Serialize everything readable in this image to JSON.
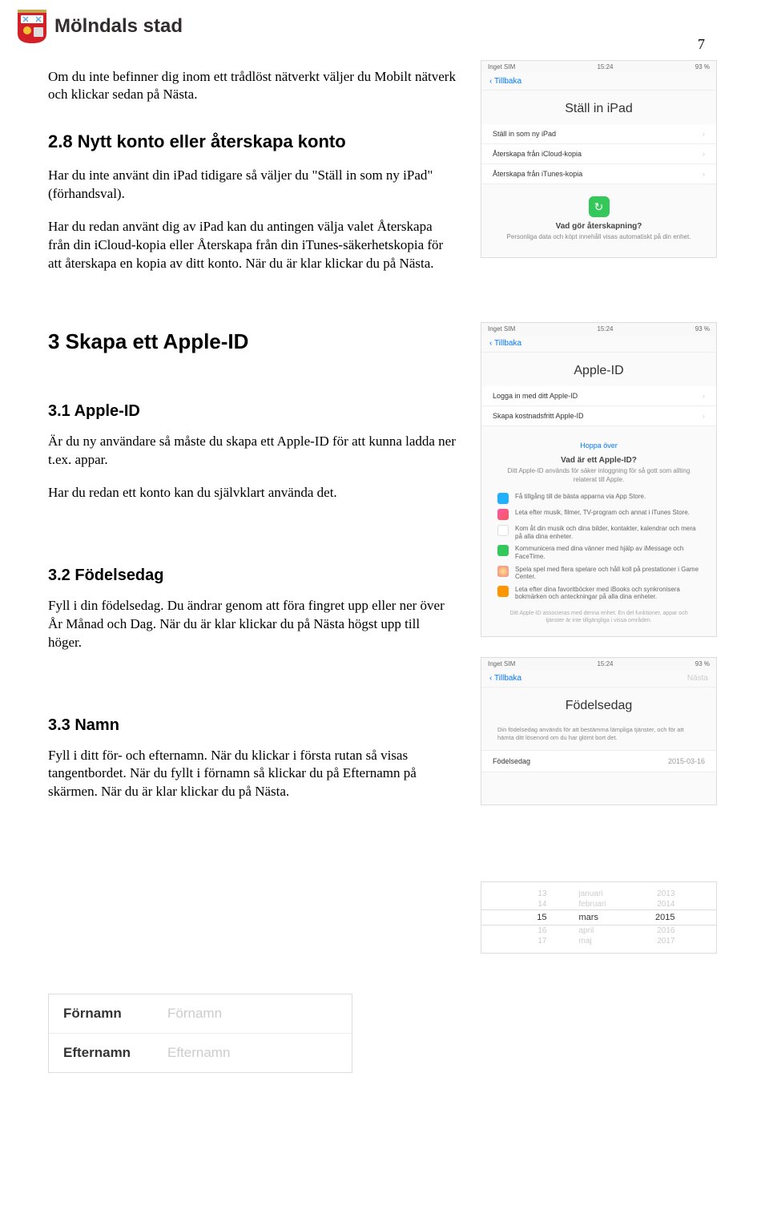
{
  "header": {
    "logo_text": "Mölndals stad",
    "page_number": "7"
  },
  "intro": "Om du inte befinner dig inom ett trådlöst nätverkt väljer du Mobilt nätverk och klickar sedan på Nästa.",
  "sec28": {
    "title": "2.8  Nytt konto eller återskapa konto",
    "p1": "Har du inte använt din iPad tidigare så väljer du \"Ställ in som ny iPad\" (förhandsval).",
    "p2": "Har du redan använt dig av iPad kan du antingen välja valet Återskapa från din iCloud-kopia eller Återskapa från din iTunes-säkerhetskopia för att återskapa en kopia av ditt konto. När du är klar klickar du på Nästa."
  },
  "sec3": {
    "title": "3  Skapa ett Apple-ID"
  },
  "sec31": {
    "title": "3.1  Apple-ID",
    "p1": "Är du ny användare så måste du skapa ett Apple-ID för att kunna ladda ner t.ex. appar.",
    "p2": "Har du redan ett konto kan du självklart använda det."
  },
  "sec32": {
    "title": "3.2  Födelsedag",
    "p1": "Fyll i din födelsedag. Du ändrar genom att föra fingret upp eller ner över År Månad och Dag. När du är klar klickar du på Nästa högst upp till höger."
  },
  "sec33": {
    "title": "3.3  Namn",
    "p1": "Fyll i ditt för- och efternamn. När du klickar i första rutan så visas tangentbordet. När du fyllt i förnamn så klickar du på Efternamn på skärmen. När du är klar klickar du på Nästa."
  },
  "ipad1": {
    "status_left": "Inget SIM",
    "status_mid": "15:24",
    "status_right": "93 %",
    "back": "Tillbaka",
    "title": "Ställ in iPad",
    "opt1": "Ställ in som ny iPad",
    "opt2": "Återskapa från iCloud-kopia",
    "opt3": "Återskapa från iTunes-kopia",
    "info_title": "Vad gör återskapning?",
    "info_desc": "Personliga data och köpt innehåll visas automatiskt på din enhet."
  },
  "ipad2": {
    "status_left": "Inget SIM",
    "status_mid": "15:24",
    "status_right": "93 %",
    "back": "Tillbaka",
    "title": "Apple-ID",
    "opt1": "Logga in med ditt Apple-ID",
    "opt2": "Skapa kostnadsfritt Apple-ID",
    "skip": "Hoppa över",
    "info_title": "Vad är ett Apple-ID?",
    "info_desc": "Ditt Apple-ID används för säker inloggning för så gott som allting relaterat till Apple.",
    "f1": "Få tillgång till de bästa apparna via App Store.",
    "f2": "Leta efter musik, filmer, TV-program och annat i iTunes Store.",
    "f3": "Kom åt din musik och dina bilder, kontakter, kalendrar och mera på alla dina enheter.",
    "f4": "Kommunicera med dina vänner med hjälp av iMessage och FaceTime.",
    "f5": "Spela spel med flera spelare och håll koll på prestationer i Game Center.",
    "f6": "Leta efter dina favoritböcker med iBooks och synkronisera bokmärken och anteckningar på alla dina enheter.",
    "fine": "Ditt Apple-ID associeras med denna enhet. En del funktioner, appar och tjänster är inte tillgängliga i vissa områden."
  },
  "ipad3": {
    "status_left": "Inget SIM",
    "status_mid": "15:24",
    "status_right": "93 %",
    "back": "Tillbaka",
    "next": "Nästa",
    "title": "Födelsedag",
    "desc": "Din födelsedag används för att bestämma lämpliga tjänster, och för att hämta ditt lösenord om du har glömt bort det.",
    "row_label": "Födelsedag",
    "row_value": "2015-03-16"
  },
  "picker": {
    "rows": [
      {
        "d": "13",
        "m": "januari",
        "y": "2013"
      },
      {
        "d": "14",
        "m": "februari",
        "y": "2014"
      },
      {
        "d": "15",
        "m": "mars",
        "y": "2015"
      },
      {
        "d": "16",
        "m": "april",
        "y": "2016"
      },
      {
        "d": "17",
        "m": "maj",
        "y": "2017"
      }
    ]
  },
  "namefields": {
    "label1": "Förnamn",
    "ph1": "Förnamn",
    "label2": "Efternamn",
    "ph2": "Efternamn"
  }
}
